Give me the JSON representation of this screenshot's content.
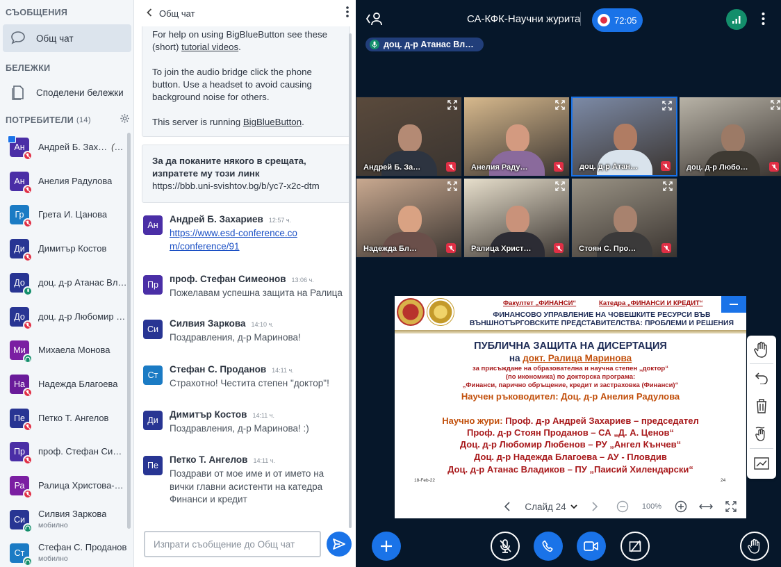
{
  "nav": {
    "messages_heading": "СЪОБЩЕНИЯ",
    "public_chat_label": "Общ чат",
    "notes_heading": "БЕЛЕЖКИ",
    "shared_notes_label": "Споделени бележки",
    "users_heading": "ПОТРЕБИТЕЛИ",
    "users_count": "(14)",
    "users": [
      {
        "initials": "Ан",
        "name": "Андрей Б. Зах…",
        "you": "(Вие)",
        "color": "#4a2ea6",
        "status": "muted",
        "presenter": true,
        "sub": ""
      },
      {
        "initials": "Ан",
        "name": "Анелия Радулова",
        "you": "",
        "color": "#4a2ea6",
        "status": "muted",
        "presenter": false,
        "sub": ""
      },
      {
        "initials": "Гр",
        "name": "Грета И. Цанова",
        "you": "",
        "color": "#1b7bc4",
        "status": "muted",
        "presenter": false,
        "sub": ""
      },
      {
        "initials": "Ди",
        "name": "Димитър Костов",
        "you": "",
        "color": "#283593",
        "status": "muted",
        "presenter": false,
        "sub": ""
      },
      {
        "initials": "До",
        "name": "доц. д-р Атанас Вла…",
        "you": "",
        "color": "#283593",
        "status": "mic",
        "presenter": false,
        "sub": ""
      },
      {
        "initials": "До",
        "name": "доц. д-р Любомир Л…",
        "you": "",
        "color": "#283593",
        "status": "muted",
        "presenter": false,
        "sub": ""
      },
      {
        "initials": "Ми",
        "name": "Михаела Монова",
        "you": "",
        "color": "#7b1fa2",
        "status": "listen",
        "presenter": false,
        "sub": ""
      },
      {
        "initials": "На",
        "name": "Надежда Благоева",
        "you": "",
        "color": "#6a1b9a",
        "status": "muted",
        "presenter": false,
        "sub": ""
      },
      {
        "initials": "Пе",
        "name": "Петко Т. Ангелов",
        "you": "",
        "color": "#283593",
        "status": "muted",
        "presenter": false,
        "sub": ""
      },
      {
        "initials": "Пр",
        "name": "проф. Стефан Сим…",
        "you": "",
        "color": "#4a2ea6",
        "status": "muted",
        "presenter": false,
        "sub": ""
      },
      {
        "initials": "Ра",
        "name": "Ралица Христова-М…",
        "you": "",
        "color": "#7b1fa2",
        "status": "muted",
        "presenter": false,
        "sub": ""
      },
      {
        "initials": "Си",
        "name": "Силвия Заркова",
        "you": "",
        "color": "#283593",
        "status": "listen",
        "presenter": false,
        "sub": "мобилно"
      },
      {
        "initials": "Ст",
        "name": "Стефан С. Проданов",
        "you": "",
        "color": "#1b7bc4",
        "status": "listen",
        "presenter": false,
        "sub": "мобилно"
      }
    ]
  },
  "chat": {
    "title": "Общ чат",
    "system_message": {
      "p1_prefix": "For help on using BigBlueButton see these (short) ",
      "p1_link": "tutorial videos",
      "p1_suffix": ".",
      "p2": "To join the audio bridge click the phone button. Use a headset to avoid causing background noise for others.",
      "p3_prefix": "This server is running ",
      "p3_link": "BigBlueButton",
      "p3_suffix": "."
    },
    "invite": {
      "text": "За да поканите някого в срещата, изпратете му този линк",
      "url": "https://bbb.uni-svishtov.bg/b/yc7-x2c-dtm"
    },
    "messages": [
      {
        "initials": "Ан",
        "color": "#4a2ea6",
        "name": "Андрей Б. Захариев",
        "time": "12:57 ч.",
        "text": "",
        "link": "https://www.esd-conference.com/conference/91"
      },
      {
        "initials": "Пр",
        "color": "#4a2ea6",
        "name": "проф. Стефан Симеонов",
        "time": "13:06 ч.",
        "text": "Пожелавам успешна защита на Ралица",
        "link": ""
      },
      {
        "initials": "Си",
        "color": "#283593",
        "name": "Силвия Заркова",
        "time": "14:10 ч.",
        "text": "Поздравления, д-р Маринова!",
        "link": ""
      },
      {
        "initials": "Ст",
        "color": "#1b7bc4",
        "name": "Стефан С. Проданов",
        "time": "14:11 ч.",
        "text": "Страхотно! Честита степен \"доктор\"!",
        "link": ""
      },
      {
        "initials": "Ди",
        "color": "#283593",
        "name": "Димитър Костов",
        "time": "14:11 ч.",
        "text": "Поздравления, д-р Маринова! :)",
        "link": ""
      },
      {
        "initials": "Пе",
        "color": "#283593",
        "name": "Петко Т. Ангелов",
        "time": "14:11 ч.",
        "text": "Поздрави от мое име и от името на вички главни асистенти на катедра Финанси и кредит",
        "link": ""
      }
    ],
    "input_placeholder": "Изпрати съобщение до Общ чат"
  },
  "main": {
    "meeting_title": "СА-КФК-Научни журита",
    "recording_time": "72:05",
    "talking_label": "доц. д-р Атанас Вл…",
    "videos": [
      {
        "name": "Андрей Б. За…",
        "active": false,
        "bg": "#5a4a3c",
        "skin": "#b48a74",
        "shirt": "#2d3440"
      },
      {
        "name": "Анелия Раду…",
        "active": false,
        "bg": "#d7b98d",
        "skin": "#d39a80",
        "shirt": "#8a6a9c"
      },
      {
        "name": "доц. д-р Атан…",
        "active": true,
        "bg": "#7c8aa6",
        "skin": "#b07c63",
        "shirt": "#d9e3ec"
      },
      {
        "name": "доц. д-р Любо…",
        "active": false,
        "bg": "#b8b3a7",
        "skin": "#9c7a66",
        "shirt": "#3e3a33"
      },
      {
        "name": "Надежда Бл…",
        "active": false,
        "bg": "#c9a990",
        "skin": "#d9a283",
        "shirt": "#6a4f4a"
      },
      {
        "name": "Ралица Христ…",
        "active": false,
        "bg": "#e7dfcc",
        "skin": "#c9927a",
        "shirt": "#2c2c34"
      },
      {
        "name": "Стоян С. Про…",
        "active": false,
        "bg": "#9a9385",
        "skin": "#a8826e",
        "shirt": "#3b3a3a"
      }
    ],
    "slide": {
      "faculty": "Факултет „ФИНАНСИ“",
      "department": "Катедра „ФИНАНСИ И КРЕДИТ“",
      "title_1": "ФИНАНСОВО УПРАВЛЕНИЕ НА ЧОВЕШКИТЕ РЕСУРСИ ВЪВ",
      "title_2": "ВЪНШНОТЪРГОВСКИТЕ ПРЕДСТАВИТЕЛСТВА: ПРОБЛЕМИ И РЕШЕНИЯ",
      "l1": "ПУБЛИЧНА ЗАЩИТА НА ДИСЕРТАЦИЯ",
      "l2a": "на ",
      "l2b": "докт. Ралица Маринова",
      "l3": "за присъждане на образователна и научна степен „доктор“",
      "l4": "(по икономика) по докторска програма:",
      "l5": "„Финанси, парично обръщение, кредит и застраховка (Финанси)“",
      "l6": "Научен ръководител: Доц. д-р Анелия Радулова",
      "l7a": "Научно жури: ",
      "l7b": "Проф. д-р Андрей Захариев",
      "l7c": " – председател",
      "l8": "Проф. д-р Стоян Проданов – СА „Д. А. Ценов“",
      "l9": "Доц. д-р Любомир Любенов – РУ „Ангел Кънчев“",
      "l10": "Доц. д-р Надежда Благоева – АУ - Пловдив",
      "l11": "Доц. д-р Атанас Владиков – ПУ „Паисий Хилендарски“",
      "date": "18-Feb-22",
      "page": "24"
    },
    "slide_selector": "Слайд 24",
    "zoom": "100%"
  }
}
